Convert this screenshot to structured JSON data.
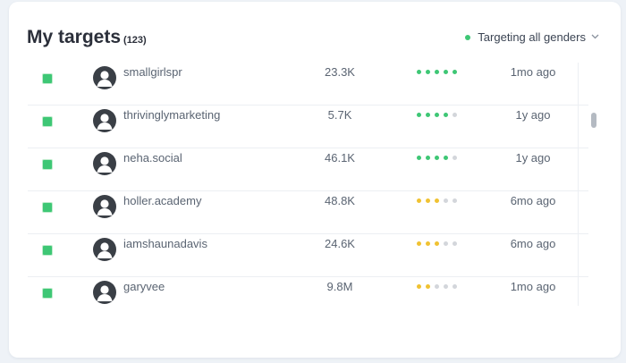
{
  "header": {
    "title": "My targets",
    "count": "(123)",
    "filter_label": "Targeting all genders",
    "filter_dot_color": "#3ec775",
    "filter_icon": "chevron-down-icon"
  },
  "colors": {
    "green": "#3ec775",
    "yellow": "#f0c232",
    "gray": "#d3d6db",
    "avatar": "#3a3f46"
  },
  "rows": [
    {
      "username": "smallgirlspr",
      "followers": "23.3K",
      "rating": 5,
      "rating_color": "green",
      "last_post": "1mo ago",
      "checked": true
    },
    {
      "username": "thrivinglymarketing",
      "followers": "5.7K",
      "rating": 4,
      "rating_color": "green",
      "last_post": "1y ago",
      "checked": true
    },
    {
      "username": "neha.social",
      "followers": "46.1K",
      "rating": 4,
      "rating_color": "green",
      "last_post": "1y ago",
      "checked": true
    },
    {
      "username": "holler.academy",
      "followers": "48.8K",
      "rating": 3,
      "rating_color": "yellow",
      "last_post": "6mo ago",
      "checked": true
    },
    {
      "username": "iamshaunadavis",
      "followers": "24.6K",
      "rating": 3,
      "rating_color": "yellow",
      "last_post": "6mo ago",
      "checked": true
    },
    {
      "username": "garyvee",
      "followers": "9.8M",
      "rating": 2,
      "rating_color": "yellow",
      "last_post": "1mo ago",
      "checked": true
    }
  ]
}
